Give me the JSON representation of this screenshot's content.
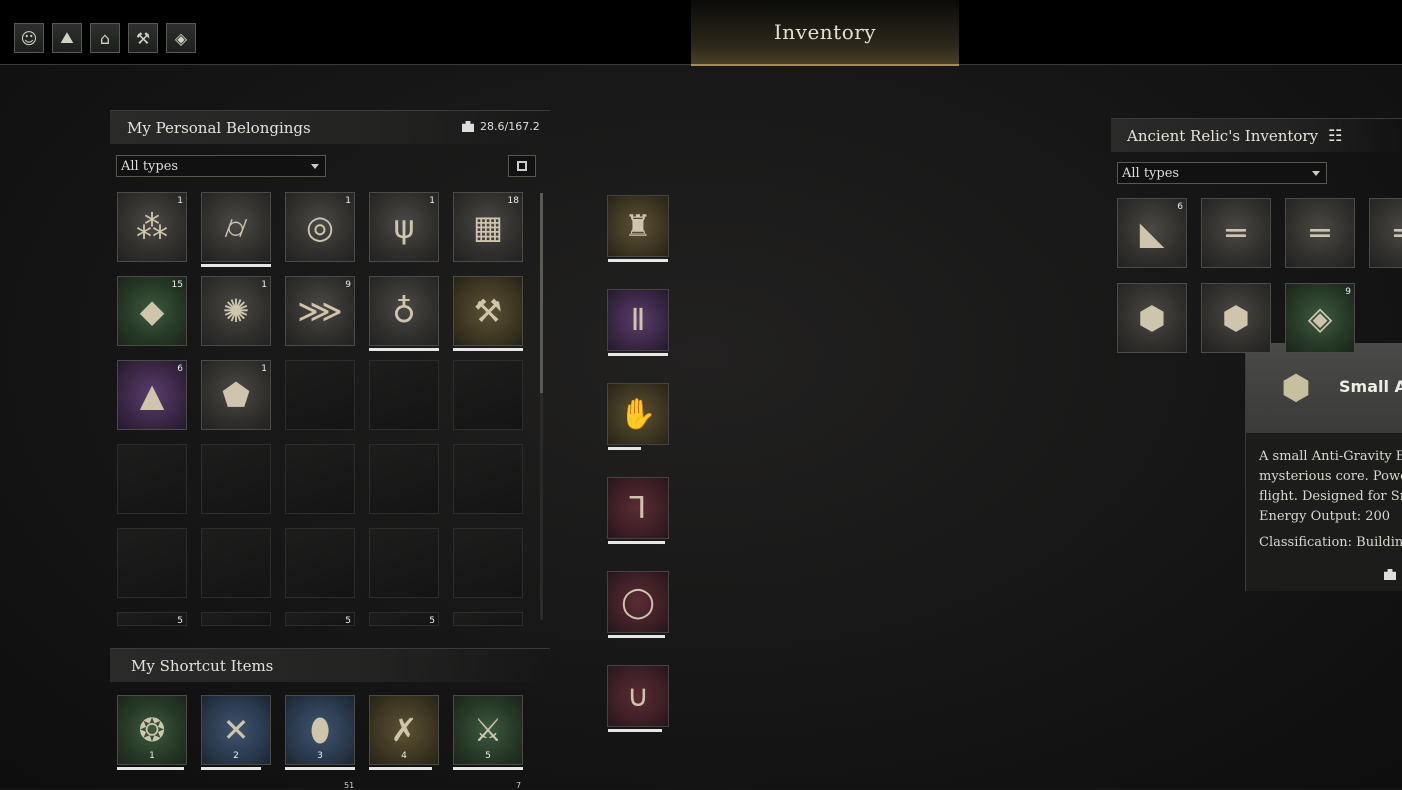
{
  "window": {
    "title": "Inventory"
  },
  "topbar": {
    "icons": [
      {
        "name": "character-icon",
        "glyph": "☺"
      },
      {
        "name": "map-icon",
        "glyph": "⛰"
      },
      {
        "name": "bag-icon",
        "glyph": "⌂"
      },
      {
        "name": "wrench-icon",
        "glyph": "⚒"
      },
      {
        "name": "drop-icon",
        "glyph": "◈"
      }
    ]
  },
  "personal": {
    "title": "My Personal Belongings",
    "weight": "28.6/167.2",
    "filter": "All types",
    "slots": [
      {
        "item": "straw-bundle",
        "count": "1",
        "rarity": "grey",
        "glyph": "⁂"
      },
      {
        "item": "rolled-canvas",
        "count": "",
        "rarity": "grey",
        "glyph": "⌭",
        "durability": 1.0
      },
      {
        "item": "rope-coil",
        "count": "1",
        "rarity": "grey",
        "glyph": "◎"
      },
      {
        "item": "branch",
        "count": "1",
        "rarity": "grey",
        "glyph": "ψ"
      },
      {
        "item": "metal-plate",
        "count": "18",
        "rarity": "grey",
        "glyph": "▦"
      },
      {
        "item": "green-crystal",
        "count": "15",
        "rarity": "green",
        "glyph": "◆"
      },
      {
        "item": "red-splatter",
        "count": "1",
        "rarity": "grey",
        "glyph": "✺"
      },
      {
        "item": "fern-log",
        "count": "9",
        "rarity": "grey",
        "glyph": "⋙"
      },
      {
        "item": "sack",
        "count": "",
        "rarity": "grey",
        "glyph": "♁",
        "durability": 1.0
      },
      {
        "item": "pickaxe",
        "count": "",
        "rarity": "gold",
        "glyph": "⚒",
        "durability": 1.0
      },
      {
        "item": "purple-prism",
        "count": "6",
        "rarity": "purple",
        "glyph": "▲"
      },
      {
        "item": "rune-stone",
        "count": "1",
        "rarity": "grey",
        "glyph": "⬟"
      },
      {
        "item": "",
        "count": "",
        "rarity": "empty",
        "glyph": ""
      },
      {
        "item": "",
        "count": "",
        "rarity": "empty",
        "glyph": ""
      },
      {
        "item": "",
        "count": "",
        "rarity": "empty",
        "glyph": ""
      },
      {
        "item": "",
        "count": "",
        "rarity": "empty",
        "glyph": ""
      },
      {
        "item": "",
        "count": "",
        "rarity": "empty",
        "glyph": ""
      },
      {
        "item": "",
        "count": "",
        "rarity": "empty",
        "glyph": ""
      },
      {
        "item": "",
        "count": "",
        "rarity": "empty",
        "glyph": ""
      },
      {
        "item": "",
        "count": "",
        "rarity": "empty",
        "glyph": ""
      },
      {
        "item": "",
        "count": "",
        "rarity": "empty",
        "glyph": ""
      },
      {
        "item": "",
        "count": "",
        "rarity": "empty",
        "glyph": ""
      },
      {
        "item": "",
        "count": "",
        "rarity": "empty",
        "glyph": ""
      },
      {
        "item": "",
        "count": "",
        "rarity": "empty",
        "glyph": ""
      },
      {
        "item": "",
        "count": "",
        "rarity": "empty",
        "glyph": ""
      },
      {
        "item": "partial",
        "count": "5",
        "rarity": "empty",
        "glyph": ""
      },
      {
        "item": "",
        "count": "",
        "rarity": "empty",
        "glyph": ""
      },
      {
        "item": "partial",
        "count": "5",
        "rarity": "empty",
        "glyph": ""
      },
      {
        "item": "partial",
        "count": "5",
        "rarity": "empty",
        "glyph": ""
      },
      {
        "item": "",
        "count": "",
        "rarity": "empty",
        "glyph": ""
      }
    ]
  },
  "shortcut": {
    "title": "My Shortcut Items",
    "slots": [
      {
        "item": "spiked-whip",
        "key": "1",
        "rarity": "green",
        "glyph": "❂",
        "durability": 0.95
      },
      {
        "item": "crossed-spears",
        "key": "2",
        "rarity": "blue",
        "glyph": "✕",
        "durability": 0.85
      },
      {
        "item": "wooden-shield",
        "key": "3",
        "rarity": "blue",
        "glyph": "⬮",
        "durability": 1.0
      },
      {
        "item": "crossed-axes",
        "key": "4",
        "rarity": "gold",
        "glyph": "✗",
        "durability": 0.9
      },
      {
        "item": "battle-axe",
        "key": "5",
        "rarity": "green",
        "glyph": "⚔",
        "durability": 1.0
      }
    ],
    "below_counts": [
      "51",
      "7"
    ]
  },
  "equipment": [
    {
      "item": "chest-armor",
      "rarity": "gold",
      "glyph": "♜",
      "durability": 1.0
    },
    {
      "item": "leg-armor",
      "rarity": "purple",
      "glyph": "Ⅱ",
      "durability": 1.0
    },
    {
      "item": "gauntlet",
      "rarity": "gold",
      "glyph": "✋",
      "durability": 0.55
    },
    {
      "item": "boots",
      "rarity": "red",
      "glyph": "⅂",
      "durability": 0.95
    },
    {
      "item": "ring",
      "rarity": "red",
      "glyph": "◯",
      "durability": 0.95
    },
    {
      "item": "necklace",
      "rarity": "red",
      "glyph": "∪",
      "durability": 0.9
    }
  ],
  "relic": {
    "title": "Ancient Relic's Inventory",
    "filter": "All types",
    "slots": [
      {
        "item": "glider-wing",
        "count": "6",
        "rarity": "grey",
        "glyph": "◣"
      },
      {
        "item": "rail-part",
        "count": "",
        "rarity": "grey",
        "glyph": "═"
      },
      {
        "item": "rail-part",
        "count": "",
        "rarity": "grey",
        "glyph": "═"
      },
      {
        "item": "rail-part",
        "count": "",
        "rarity": "grey",
        "glyph": "═"
      },
      {
        "item": "engine-core",
        "count": "",
        "rarity": "grey",
        "glyph": "⬢"
      },
      {
        "item": "engine-core",
        "count": "",
        "rarity": "grey",
        "glyph": "⬢"
      },
      {
        "item": "green-gem",
        "count": "9",
        "rarity": "green",
        "glyph": "◈"
      }
    ]
  },
  "tooltip": {
    "title": "Small Ar",
    "lines": [
      "A small Anti-Gravity Eng",
      "mysterious core. Power",
      "flight. Designed for Sma",
      "Energy Output: 200"
    ],
    "classification": "Classification: Buildings"
  }
}
